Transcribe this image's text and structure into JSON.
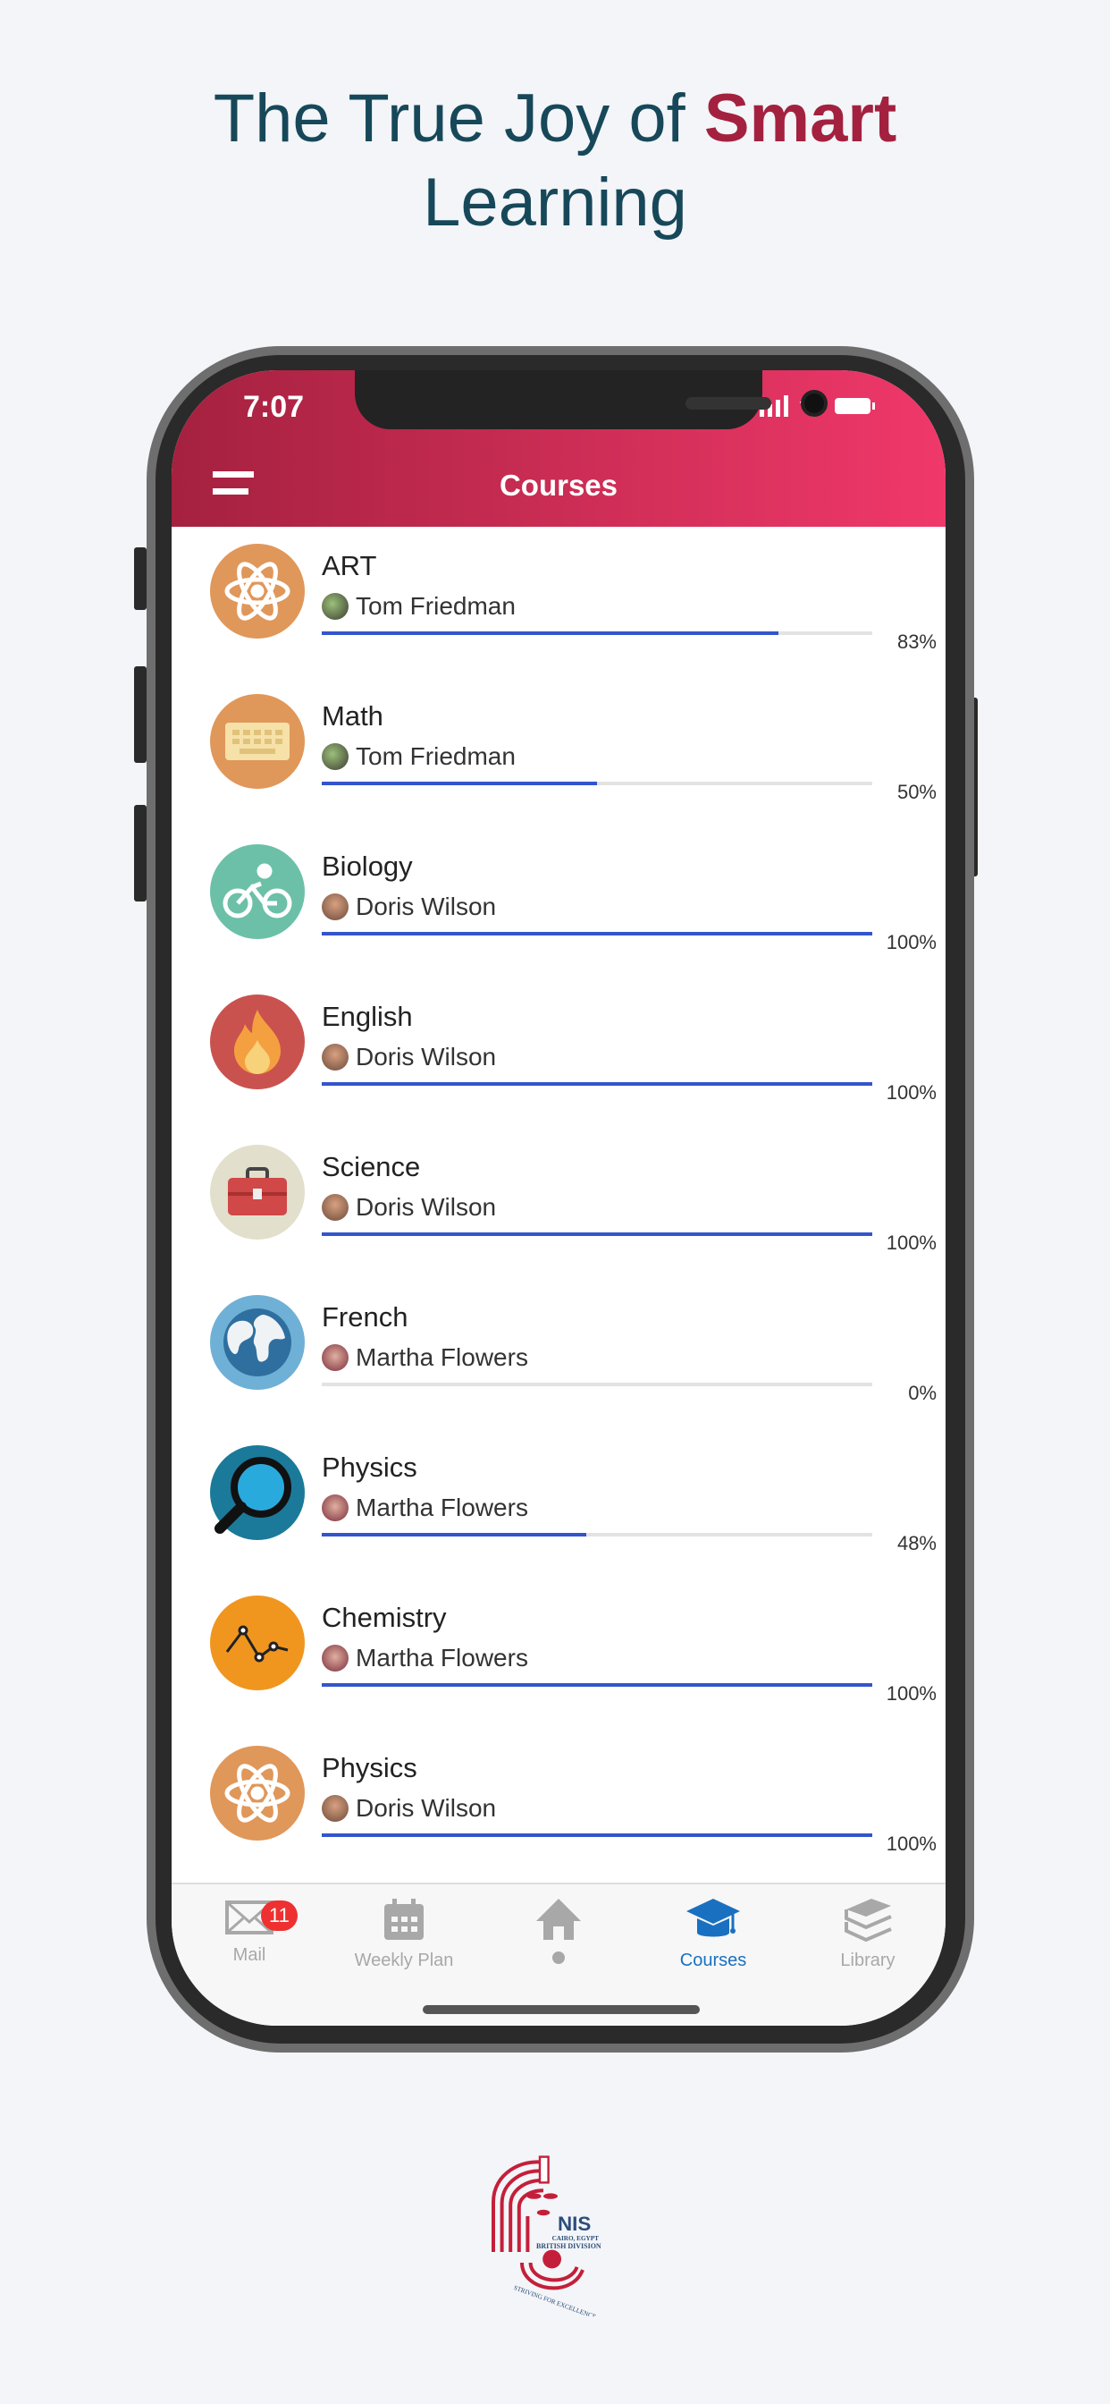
{
  "headline": {
    "line1": "The True Joy of ",
    "highlight": "Smart",
    "line2": "Learning"
  },
  "status": {
    "time": "7:07"
  },
  "header": {
    "title": "Courses"
  },
  "colors": {
    "header_start": "#a5213f",
    "header_end": "#f0386a",
    "progress": "#3355cc",
    "active_tab": "#1a70c0",
    "highlight": "#a3213f"
  },
  "courses": [
    {
      "name": "ART",
      "teacher": "Tom Friedman",
      "progress": 83,
      "label": "83%",
      "icon": "atom-icon",
      "color": "#e0975a"
    },
    {
      "name": "Math",
      "teacher": "Tom Friedman",
      "progress": 50,
      "label": "50%",
      "icon": "keyboard-icon",
      "color": "#e0975a"
    },
    {
      "name": "Biology",
      "teacher": "Doris Wilson",
      "progress": 100,
      "label": "100%",
      "icon": "bicycle-icon",
      "color": "#6cc0a8"
    },
    {
      "name": "English",
      "teacher": "Doris Wilson",
      "progress": 100,
      "label": "100%",
      "icon": "flame-icon",
      "color": "#c9524f"
    },
    {
      "name": "Science",
      "teacher": "Doris Wilson",
      "progress": 100,
      "label": "100%",
      "icon": "toolbox-icon",
      "color": "#e2dfcc"
    },
    {
      "name": "French",
      "teacher": "Martha Flowers",
      "progress": 0,
      "label": "0%",
      "icon": "globe-icon",
      "color": "#6fb0d6"
    },
    {
      "name": "Physics",
      "teacher": "Martha Flowers",
      "progress": 48,
      "label": "48%",
      "icon": "magnifier-icon",
      "color": "#1b7a9a"
    },
    {
      "name": "Chemistry",
      "teacher": "Martha Flowers",
      "progress": 100,
      "label": "100%",
      "icon": "line-chart-icon",
      "color": "#f0961f"
    },
    {
      "name": "Physics",
      "teacher": "Doris Wilson",
      "progress": 100,
      "label": "100%",
      "icon": "atom-icon",
      "color": "#e0975a"
    }
  ],
  "tabs": [
    {
      "label": "Mail",
      "icon": "mail-icon",
      "badge": "11"
    },
    {
      "label": "Weekly Plan",
      "icon": "calendar-icon"
    },
    {
      "label": "",
      "icon": "home-icon"
    },
    {
      "label": "Courses",
      "icon": "graduation-cap-icon",
      "active": true
    },
    {
      "label": "Library",
      "icon": "books-icon"
    }
  ],
  "logo": {
    "name": "NIS",
    "line1": "CAIRO, EGYPT",
    "line2": "BRITISH DIVISION",
    "motto": "STRIVING FOR EXCELLENCE"
  }
}
